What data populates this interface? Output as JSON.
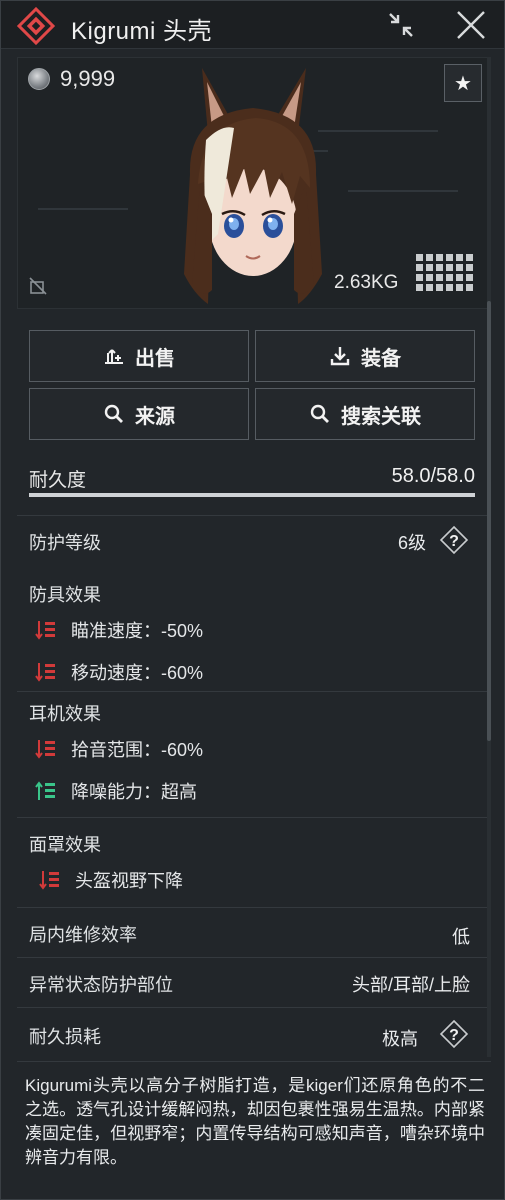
{
  "window": {
    "title": "Kigrumi 头壳"
  },
  "preview": {
    "currency_value": "9,999",
    "weight": "2.63KG"
  },
  "actions": {
    "sell": "出售",
    "equip": "装备",
    "source": "来源",
    "search_related": "搜索关联"
  },
  "durability": {
    "label": "耐久度",
    "value": "58.0/58.0",
    "ratio": 1.0
  },
  "protection_level": {
    "label": "防护等级",
    "value": "6级"
  },
  "armor_effects": {
    "title": "防具效果",
    "items": [
      {
        "text": "瞄准速度：-50%",
        "type": "negative"
      },
      {
        "text": "移动速度：-60%",
        "type": "negative"
      }
    ]
  },
  "headset_effects": {
    "title": "耳机效果",
    "items": [
      {
        "text": "拾音范围：-60%",
        "type": "negative"
      },
      {
        "text": "降噪能力：超高",
        "type": "positive"
      }
    ]
  },
  "mask_effects": {
    "title": "面罩效果",
    "items": [
      {
        "text": "头盔视野下降",
        "type": "negative"
      }
    ]
  },
  "repair_efficiency": {
    "label": "局内维修效率",
    "value": "低"
  },
  "status_protection": {
    "label": "异常状态防护部位",
    "value": "头部/耳部/上脸"
  },
  "durability_loss": {
    "label": "耐久损耗",
    "value": "极高"
  },
  "description": "Kigurumi头壳以高分子树脂打造，是kiger们还原角色的不二之选。透气孔设计缓解闷热，却因包裹性强易生温热。内部紧凑固定佳，但视野窄；内置传导结构可感知声音，嘈杂环境中辨音力有限。",
  "colors": {
    "negative": "#d23a3a",
    "positive": "#3ac58a",
    "accent": "#e04848"
  }
}
